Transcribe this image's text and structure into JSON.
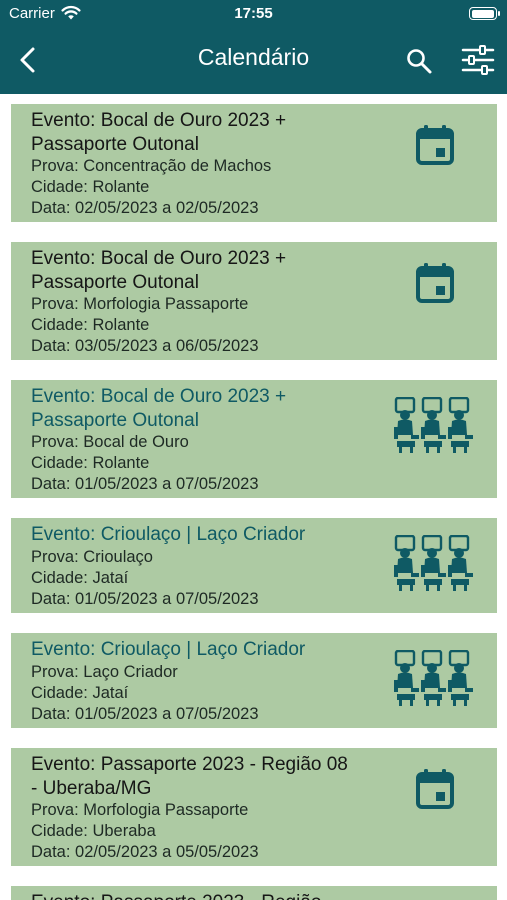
{
  "status_bar": {
    "carrier": "Carrier",
    "time": "17:55"
  },
  "header": {
    "title": "Calendário",
    "back_icon": "chevron-left-icon",
    "search_icon": "search-icon",
    "filter_icon": "sliders-icon"
  },
  "colors": {
    "header": "#0f5a64",
    "card": "#adcaa3",
    "accent": "#0f5a64"
  },
  "events": [
    {
      "evento": "Evento: Bocal de Ouro 2023 + Passaporte Outonal",
      "prova": "Prova: Concentração de Machos",
      "cidade": "Cidade: Rolante",
      "data": "Data: 02/05/2023 a 02/05/2023",
      "icon": "calendar-icon",
      "highlight": false
    },
    {
      "evento": "Evento: Bocal de Ouro 2023 + Passaporte Outonal",
      "prova": "Prova: Morfologia Passaporte",
      "cidade": "Cidade: Rolante",
      "data": "Data: 03/05/2023 a 06/05/2023",
      "icon": "calendar-icon",
      "highlight": false
    },
    {
      "evento": "Evento: Bocal de Ouro 2023 + Passaporte Outonal",
      "prova": "Prova: Bocal de Ouro",
      "cidade": "Cidade: Rolante",
      "data": "Data: 01/05/2023 a 07/05/2023",
      "icon": "judges-icon",
      "highlight": true
    },
    {
      "evento": "Evento: Crioulaço | Laço Criador",
      "prova": "Prova: Crioulaço",
      "cidade": "Cidade: Jataí",
      "data": "Data: 01/05/2023 a 07/05/2023",
      "icon": "judges-icon",
      "highlight": true
    },
    {
      "evento": "Evento: Crioulaço | Laço Criador",
      "prova": "Prova: Laço Criador",
      "cidade": "Cidade: Jataí",
      "data": "Data: 01/05/2023 a 07/05/2023",
      "icon": "judges-icon",
      "highlight": true
    },
    {
      "evento": "Evento: Passaporte 2023 - Região 08 - Uberaba/MG",
      "prova": "Prova: Morfologia Passaporte",
      "cidade": "Cidade: Uberaba",
      "data": "Data: 02/05/2023 a 05/05/2023",
      "icon": "calendar-icon",
      "highlight": false
    },
    {
      "evento": "Evento: Passaporte 2023 - Região",
      "prova": "",
      "cidade": "",
      "data": "",
      "icon": "",
      "highlight": false
    }
  ]
}
